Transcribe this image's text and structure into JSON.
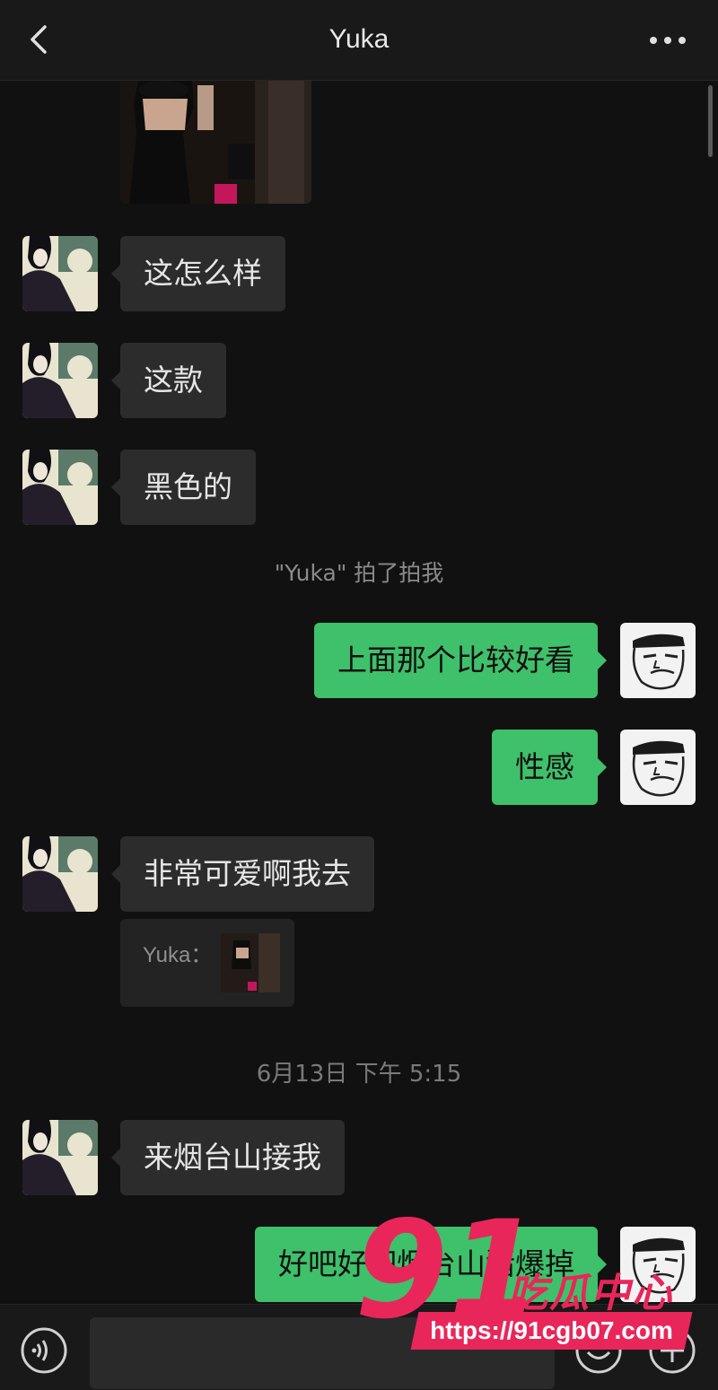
{
  "header": {
    "title": "Yuka"
  },
  "system": {
    "pat_text": "\"Yuka\" 拍了拍我",
    "timestamp": "6月13日 下午 5:15"
  },
  "messages": [
    {
      "text": "这怎么样"
    },
    {
      "text": "这款"
    },
    {
      "text": "黑色的"
    },
    {
      "text": "上面那个比较好看"
    },
    {
      "text": "性感"
    },
    {
      "text": "非常可爱啊我去"
    },
    {
      "text": "来烟台山接我"
    },
    {
      "text": "好吧好吧烟台山猪爆掉"
    }
  ],
  "quote": {
    "name": "Yuka："
  },
  "watermark": {
    "number": "91",
    "name": "吃瓜中心",
    "url": "https://91cgb07.com"
  },
  "colors": {
    "sent_bubble": "#3fc06a",
    "received_bubble": "#2c2c2c",
    "background": "#111111",
    "watermark": "#e8265a"
  }
}
